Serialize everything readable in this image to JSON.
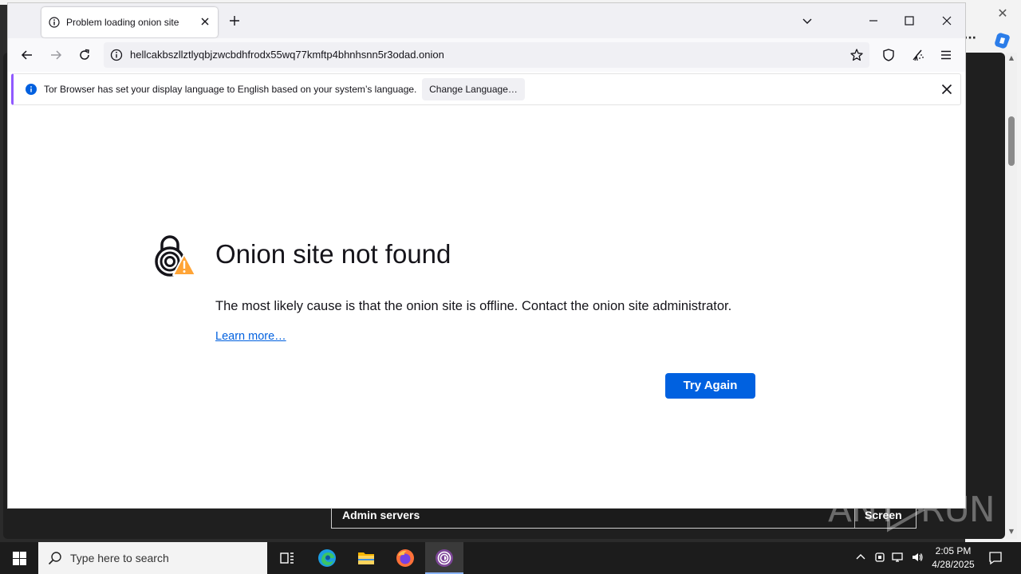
{
  "browser": {
    "tab_title": "Problem loading onion site",
    "url": "hellcakbszllztlyqbjzwcbdhfrodx55wq77kmftp4bhnhsnn5r3odad.onion",
    "accent_color": "#9059ff"
  },
  "notification": {
    "message": "Tor Browser has set your display language to English based on your system’s language.",
    "button_label": "Change Language…"
  },
  "error_page": {
    "title": "Onion site not found",
    "description": "The most likely cause is that the onion site is offline. Contact the onion site administrator.",
    "learn_more": "Learn more…",
    "try_again": "Try Again",
    "button_color": "#0061e0"
  },
  "background_app": {
    "bar_label": "Admin servers",
    "screen_button": "Screen"
  },
  "watermark": {
    "left": "ANY",
    "right": "RUN"
  },
  "taskbar": {
    "search_placeholder": "Type here to search",
    "time": "2:05 PM",
    "date": "4/28/2025",
    "apps": [
      "task-view",
      "edge",
      "file-explorer",
      "firefox",
      "tor-browser"
    ]
  }
}
